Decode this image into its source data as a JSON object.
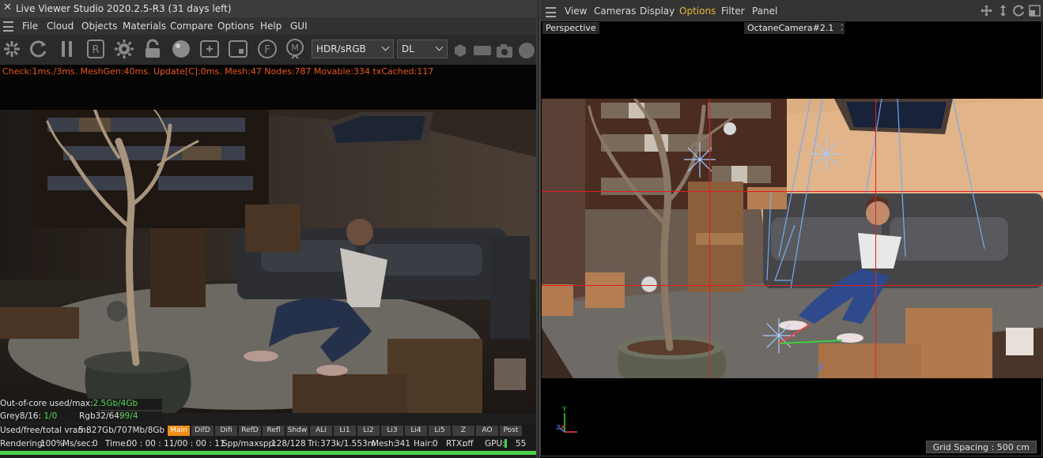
{
  "live_viewer": {
    "close_glyph": "✕",
    "title": "Live Viewer Studio 2020.2.5-R3 (31 days left)",
    "menu": [
      "File",
      "Cloud",
      "Objects",
      "Materials",
      "Compare",
      "Options",
      "Help",
      "GUI"
    ],
    "toolbar_icons": [
      "pin-send-icon",
      "refresh-icon",
      "pause-icon",
      "region-render-icon",
      "settings-gear-icon",
      "lock-icon",
      "material-ball-icon",
      "add-region-icon",
      "clay-mode-icon",
      "film-f-icon",
      "marker-pin-icon"
    ],
    "tonemap_select": "HDR/sRGB",
    "kernel_select": "DL",
    "right_icons": [
      "sphere-icon",
      "rect-icon",
      "camera-snapshot-icon",
      "circle-icon"
    ],
    "stats_line": "Check:1ms./3ms. MeshGen:40ms. Update[C]:0ms. Mesh:47 Nodes:787 Movable:334 txCached:117",
    "info": {
      "out_of_core_label": "Out-of-core used/max:",
      "out_of_core_value": "2.5Gb/4Gb",
      "grey_label": "Grey8/16:",
      "grey_value": "1/0",
      "rgb_label": "Rgb32/64:",
      "rgb_value": "99/4",
      "vram_label": "Used/free/total vram:",
      "vram_value": "5.827Gb/707Mb/8Gb"
    },
    "passes": [
      "Main",
      "DifD",
      "Difi",
      "RefD",
      "Refl",
      "Shdw",
      "ALi",
      "Li1",
      "Li2",
      "Li3",
      "Li4",
      "Li5",
      "Z",
      "AO",
      "Post"
    ],
    "active_pass": "Main",
    "status": {
      "rendering_label": "Rendering:",
      "rendering_value": "100%",
      "mssec_label": "Ms/sec:",
      "mssec_value": "0",
      "time_label": "Time:",
      "time_value": "00 : 00 : 11/00 : 00 : 11",
      "spp_label": "Spp/maxspp:",
      "spp_value": "128/128",
      "tri_label": "Tri:",
      "tri_value": "373k/1.553m",
      "mesh_label": "Mesh:",
      "mesh_value": "341",
      "hair_label": "Hair:",
      "hair_value": "0",
      "rtx_label": "RTX:",
      "rtx_value": "off",
      "gpu_label": "GPU:",
      "gpu_value": "55"
    },
    "progress": 1.0
  },
  "viewport": {
    "menu": [
      "View",
      "Cameras",
      "Display",
      "Options",
      "Filter",
      "Panel"
    ],
    "highlighted_menu": "Options",
    "nav_icons": [
      "move-view-icon",
      "zoom-view-icon",
      "rotate-view-icon",
      "maximize-view-icon"
    ],
    "view_label": "Perspective",
    "camera_label": "OctaneCamera#2.1",
    "grid_spacing": "Grid Spacing : 500 cm",
    "axis_labels": {
      "x": "X",
      "y": "Y",
      "z": "Z"
    }
  },
  "colors": {
    "stats_text": "#e8571c",
    "value_green": "#55d455",
    "active_pass": "#f08c18",
    "menu_highlight": "#e8b93b",
    "grid_red": "#e02020"
  }
}
